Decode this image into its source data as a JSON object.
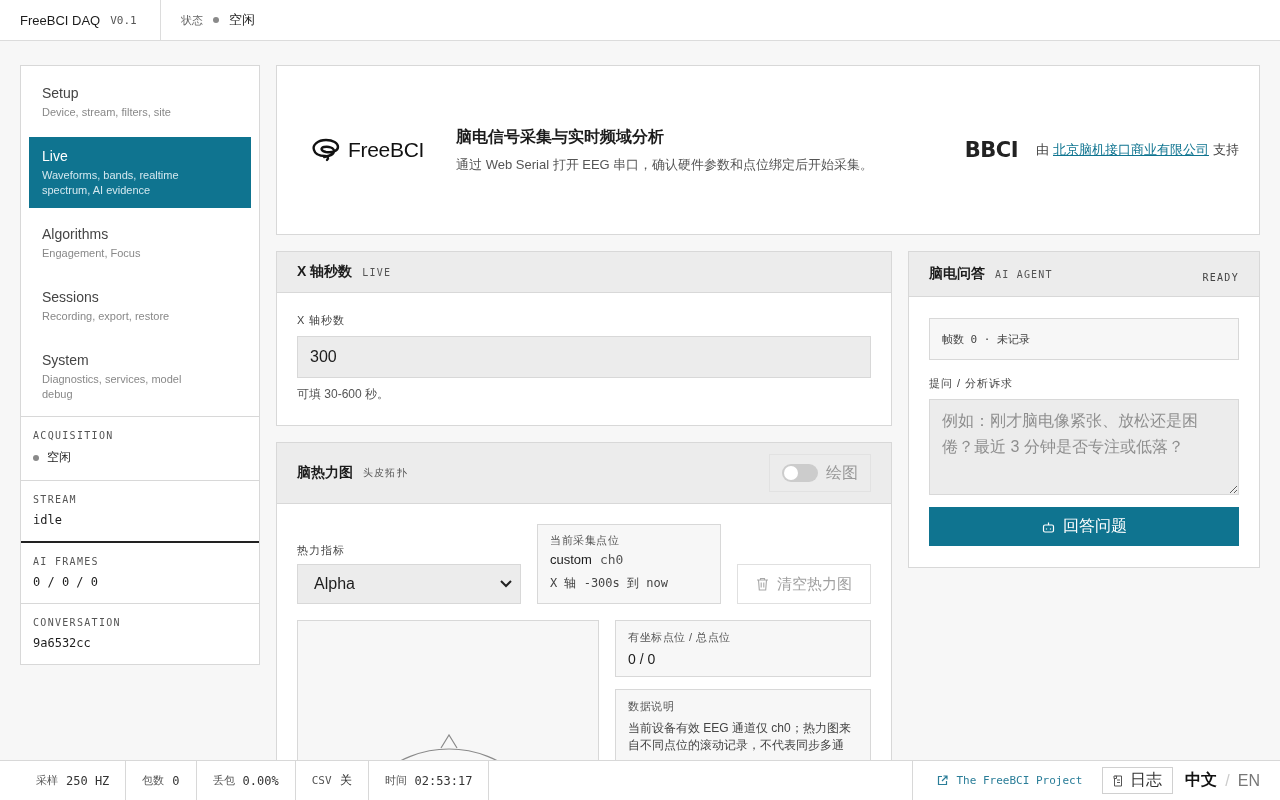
{
  "header": {
    "brand": "FreeBCI DAQ",
    "version": "V0.1",
    "status_label": "状态",
    "status": "空闲"
  },
  "sidebar": {
    "nav": [
      {
        "title": "Setup",
        "subtitle": "Device, stream, filters, site",
        "selected": false
      },
      {
        "title": "Live",
        "subtitle": "Waveforms, bands, realtime spectrum, AI evidence",
        "selected": true
      },
      {
        "title": "Algorithms",
        "subtitle": "Engagement, Focus",
        "selected": false
      },
      {
        "title": "Sessions",
        "subtitle": "Recording, export, restore",
        "selected": false
      },
      {
        "title": "System",
        "subtitle": "Diagnostics, services, model debug",
        "selected": false
      }
    ],
    "stats": [
      {
        "label": "ACQUISITION",
        "value": "空闲",
        "kind": "status"
      },
      {
        "label": "STREAM",
        "value": "idle",
        "kind": "mono"
      },
      {
        "label": "AI FRAMES",
        "value": "0 / 0 / 0",
        "kind": "mono"
      },
      {
        "label": "CONVERSATION",
        "value": "9a6532cc",
        "kind": "mono"
      }
    ]
  },
  "hero": {
    "logo": "FreeBCI",
    "title": "脑电信号采集与实时频域分析",
    "description": "通过 Web Serial 打开 EEG 串口，确认硬件参数和点位绑定后开始采集。",
    "partner_logo": "BBCI",
    "sponsor_prefix": "由",
    "sponsor_link": "北京脑机接口商业有限公司",
    "sponsor_suffix": "支持"
  },
  "x_panel": {
    "title": "X 轴秒数",
    "tag": "LIVE",
    "field_label": "X 轴秒数",
    "value": "300",
    "hint": "可填 30-600 秒。"
  },
  "heatmap_panel": {
    "title": "脑热力图",
    "tag": "头皮拓扑",
    "toggle": {
      "label": "绘图",
      "on": false,
      "disabled": true
    },
    "metric_label": "热力指标",
    "metric": "Alpha",
    "current": {
      "label": "当前采集点位",
      "site": "custom",
      "channel": "ch0",
      "range": "X 轴 -300s 到 now"
    },
    "clear_button": {
      "label": "清空热力图",
      "disabled": true
    },
    "points": {
      "label": "有坐标点位 / 总点位",
      "value": "0 / 0"
    },
    "note": {
      "label": "数据说明",
      "text": "当前设备有效 EEG 通道仅 ch0；热力图来自不同点位的滚动记录，不代表同步多通"
    }
  },
  "ai_panel": {
    "title": "脑电问答",
    "tag": "AI AGENT",
    "status": "READY",
    "frames": "帧数 0 · 未记录",
    "question_label": "提问 / 分析诉求",
    "placeholder": "例如：刚才脑电像紧张、放松还是困倦？最近 3 分钟是否专注或低落？",
    "submit": "回答问题"
  },
  "status_bar": {
    "items": [
      {
        "label": "采样",
        "value": "250 HZ"
      },
      {
        "label": "包数",
        "value": "0"
      },
      {
        "label": "丢包",
        "value": "0.00%"
      },
      {
        "label": "CSV",
        "value": "关"
      },
      {
        "label": "时间",
        "value": "02:53:17"
      }
    ],
    "link": "The FreeBCI Project",
    "log_button": "日志",
    "language_separator": "/",
    "languages": [
      {
        "label": "中文",
        "selected": true
      },
      {
        "label": "EN",
        "selected": false
      }
    ]
  }
}
